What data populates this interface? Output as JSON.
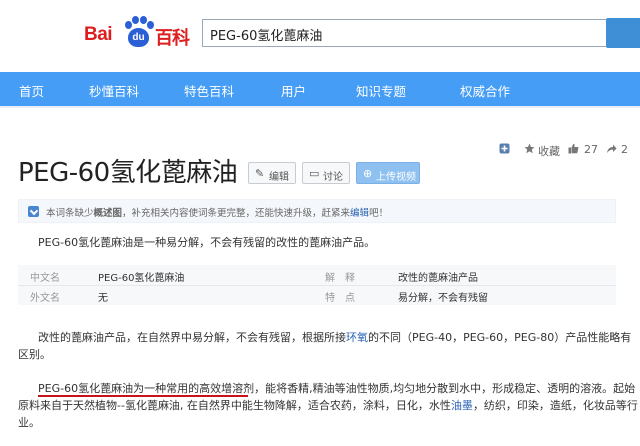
{
  "header": {
    "logo": {
      "text_bai": "Bai",
      "text_du": "du",
      "text_baike": "百科"
    },
    "search_value": "PEG-60氢化蓖麻油"
  },
  "nav": {
    "items": [
      "首页",
      "秒懂百科",
      "特色百科",
      "用户",
      "知识专题",
      "权威合作"
    ]
  },
  "tools": {
    "favorite_label": "收藏",
    "like_count": "27",
    "share_count": "2"
  },
  "entry": {
    "title": "PEG-60氢化蓖麻油",
    "edit_label": "编辑",
    "discuss_label": "讨论",
    "upload_label": "上传视频"
  },
  "notice": {
    "prefix": "本词条缺少",
    "link1": "概述图",
    "middle": "，补充相关内容使词条更完整，还能快速升级，赶紧来",
    "link2": "编辑",
    "suffix": "吧！"
  },
  "summary": "PEG-60氢化蓖麻油是一种易分解，不会有残留的改性的蓖麻油产品。",
  "basic_info": {
    "rows": [
      {
        "label1": "中文名",
        "value1": "PEG-60氢化蓖麻油",
        "label2": "解　释",
        "value2": "改性的蓖麻油产品"
      },
      {
        "label1": "外文名",
        "value1": "无",
        "label2": "特　点",
        "value2": "易分解，不会有残留"
      }
    ]
  },
  "para1": {
    "line1_a": "改性的蓖麻油产品，在自然界中易分解，不会有残留，根据所接",
    "line1_kw": "环氧",
    "line1_b": "的不同（PEG-40，PEG-60，PEG-80）产品性能略有",
    "line2": "区别。"
  },
  "para2": {
    "line1_a": "PEG-60氢化蓖麻油为一种常用的高效增溶剂",
    "line1_b": "，能将香精,精油等油性物质,均匀地分散到水中，形成稳定、透明的溶液。起始",
    "line2": "原料来自于天然植物--氢化蓖麻油, 在自然界中能生物降解，适合农药，涂料，日化，水性",
    "line2_kw": "油墨",
    "line2_b": "，纺织，印染，造纸，化妆品等行",
    "line3": "业。"
  },
  "colors": {
    "nav_bg": "#459df5",
    "logo_red": "#de1f1f",
    "logo_blue": "#2a5fd6",
    "link_blue": "#2b63b6",
    "underline_red": "#c8131b"
  }
}
